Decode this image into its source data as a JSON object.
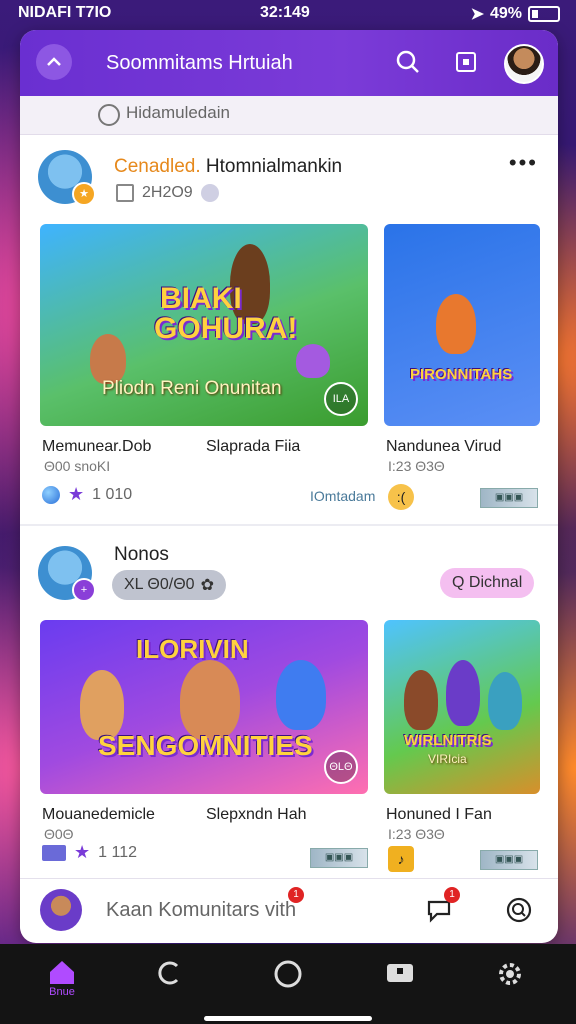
{
  "status_bar": {
    "left": "NIDAFI T7IO",
    "time": "32:149",
    "battery": "49%"
  },
  "header": {
    "title": "Soommitams Hrtuiah"
  },
  "search": {
    "text": "Hidamuledain"
  },
  "post1": {
    "tag": "Cenadled.",
    "title": "Htomnialmankin",
    "meta": "2H2O9",
    "card_main": {
      "big_word_1": "BIAKI",
      "big_word_2": "GOHURA!",
      "overlay": "Pliodn Reni Onunitan",
      "play": "ILA"
    },
    "card_side": {
      "big_word": "PIRONNITAHS"
    },
    "cards": [
      {
        "title": "Memunear.Dob",
        "sub": "Θ00 snoKI"
      },
      {
        "title": "Slaprada Fiia",
        "sub": ""
      },
      {
        "title": "Nanduneа Virud",
        "sub": "I:23 Θ3Θ"
      }
    ],
    "stats": {
      "count": "1 010",
      "label": "IOmtadam"
    }
  },
  "post2": {
    "title": "Nonos",
    "chip_left": "XL Θ0/Θ0",
    "chip_right": "Q Dichnal",
    "card_main": {
      "big_word_1": "ILORIVIN",
      "big_word_2": "SENGOMNITIES",
      "play": "ΘLΘ"
    },
    "card_side": {
      "big_word": "WIRLNITRIS",
      "sub_word": "VIRIcia"
    },
    "cards": [
      {
        "title": "Mouanedemicle",
        "sub": "Θ0Θ"
      },
      {
        "title": "Slepxndn Hah",
        "sub": ""
      },
      {
        "title": "Honuned I Fan",
        "sub": "I:23 Θ3Θ"
      }
    ],
    "stats": {
      "count": "1 112"
    }
  },
  "composer": {
    "placeholder": "Kaan Komunitars vith",
    "notif1": "1",
    "notif2": "1"
  },
  "nav": [
    {
      "label": "Bnue",
      "icon": "home-icon"
    },
    {
      "label": "",
      "icon": "chat-icon"
    },
    {
      "label": "",
      "icon": "circle-icon"
    },
    {
      "label": "",
      "icon": "briefcase-icon"
    },
    {
      "label": "",
      "icon": "gear-icon"
    }
  ],
  "colors": {
    "accent": "#7b3bd8",
    "header": "#6a2fd1",
    "tag": "#e6891c"
  }
}
